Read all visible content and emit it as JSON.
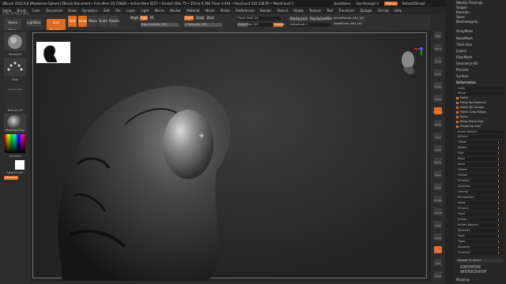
{
  "titlebar": {
    "title": "ZBrush 2022.0.8 [Madeleine Sphere]   ZBrush Document    • Free Mem 10.738GB • Active Mem 6227 • Scratch Disk 75 • ZTime 0.786 Timer 0.944 • PolyCount 542.158 KP • MeshCount 1",
    "menus_right": [
      "QuickSave",
      "See-through 0",
      "Menus",
      "DefaultZScript"
    ]
  },
  "coords": "0.56,-0.743,-0.624",
  "menubar": [
    "Alpha",
    "Brush",
    "Color",
    "Document",
    "Draw",
    "Dynamics",
    "Edit",
    "File",
    "Layer",
    "Light",
    "Macro",
    "Marker",
    "Material",
    "Movie",
    "Picker",
    "Preferences",
    "Render",
    "Stencil",
    "Stroke",
    "Texture",
    "Tool",
    "Transform",
    "Zplugin",
    "Zscript",
    "Help"
  ],
  "toolbar": {
    "home_page": "Home Page",
    "lightbox": "LightBox",
    "live_boolean": "Live Boolean",
    "edit": "Edit",
    "draw": "Draw",
    "move": "Move",
    "scale": "Scale",
    "rotate": "Rotate",
    "mrgb": "Mrgb",
    "rgb": "Rgb",
    "m": "M",
    "zadd": "Zadd",
    "zsub": "Zsub",
    "zcut": "Zcut",
    "rgb_intensity": "Rgb Intensity 100",
    "z_intensity": "Z Intensity 100",
    "focal_shift": "Focal Shift -45",
    "draw_size": "Draw Size 125",
    "dynamic": "Dynamic",
    "replay_last": "ReplayLast",
    "replay_last_rel": "ReplayLastRel",
    "active_points": "ActivePoints: 661,187",
    "total_points": "TotalPoints: 661,187",
    "adjust_last": "AdjustLast 1"
  },
  "leftshelf": {
    "brush_label": "Standard",
    "stroke_label": "Dots",
    "alpha_label": "Alpha Off",
    "texture_label": "Texture Off",
    "material_label": "MatCap Gray",
    "gradient_label": "Gradient",
    "switch_color_label": "SwitchColor",
    "alternate_label": "Alternate"
  },
  "rightshelf": [
    "BPR",
    "SPix 3",
    "Scroll",
    "Zoom",
    "Actual",
    "AAHalf",
    "Dynamic",
    "Persp",
    "Floor",
    "Local",
    "Frame",
    "Move",
    "Scale",
    "Rotate",
    "Line Fill",
    "PolyF",
    "Transp",
    "Ghost",
    "Solo",
    "Xpose"
  ],
  "rightpanel": {
    "top_items": [
      "Weekly Trainings",
      "Stages",
      "Revision",
      "Store",
      "Meshintegrity"
    ],
    "section_items": [
      "ArrayMesh",
      "NanoMesh",
      "Thick Skin",
      "Layers",
      "FiberMesh",
      "Geometry HD",
      "Preview",
      "Surface",
      "Deformation"
    ],
    "sliders": [
      "Unify",
      "Mirror",
      "Polish",
      "Polish By Features",
      "Polish By Groups",
      "Polish Crisp Edges",
      "Relax",
      "Relax Plane Grid",
      "Project to Grid",
      "Smart ReSym",
      "ReSym",
      "Offset",
      "Rotate",
      "Size",
      "Bend",
      "Skew",
      "SSkew",
      "Flatten",
      "SFlatten",
      "Spherize",
      "Gravity",
      "Perspective",
      "Noise",
      "Smooth",
      "Swell",
      "Inflate",
      "Inflate Balloon",
      "Spherize",
      "Twist",
      "Taper",
      "Squeeze",
      "Contract"
    ],
    "bottom_items": [
      "Repeat To Active",
      "Masking"
    ],
    "watermark": "GNOMON WORKSHOP"
  },
  "colors": {
    "accent": "#e06b22",
    "panel": "#272727",
    "viewport": "#2e2e2e"
  }
}
